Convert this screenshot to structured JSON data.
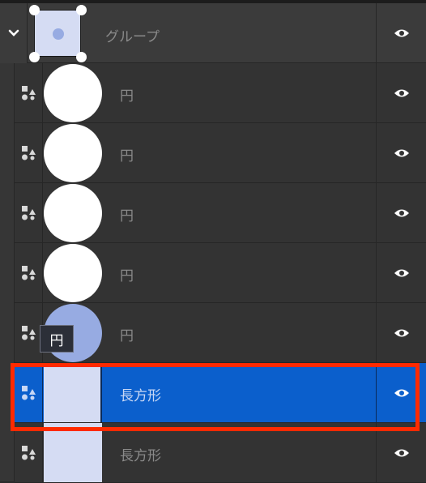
{
  "group": {
    "label": "グループ",
    "expanded": true,
    "visibility_icon": "eye-icon",
    "expand_icon": "chevron-down-icon"
  },
  "layers": [
    {
      "label": "円",
      "kind": "circle",
      "fill": "#ffffff",
      "selected": false
    },
    {
      "label": "円",
      "kind": "circle",
      "fill": "#ffffff",
      "selected": false
    },
    {
      "label": "円",
      "kind": "circle",
      "fill": "#ffffff",
      "selected": false
    },
    {
      "label": "円",
      "kind": "circle",
      "fill": "#ffffff",
      "selected": false
    },
    {
      "label": "円",
      "kind": "circle",
      "fill": "#97abe2",
      "selected": false
    },
    {
      "label": "長方形",
      "kind": "rectangle",
      "fill": "#d5dcf3",
      "selected": true
    },
    {
      "label": "長方形",
      "kind": "rectangle",
      "fill": "#d5dcf3",
      "selected": false
    }
  ],
  "tooltip": {
    "text": "円"
  },
  "colors": {
    "selection": "#0b5fcc",
    "highlight_border": "#ff2a00",
    "panel": "#333333"
  }
}
